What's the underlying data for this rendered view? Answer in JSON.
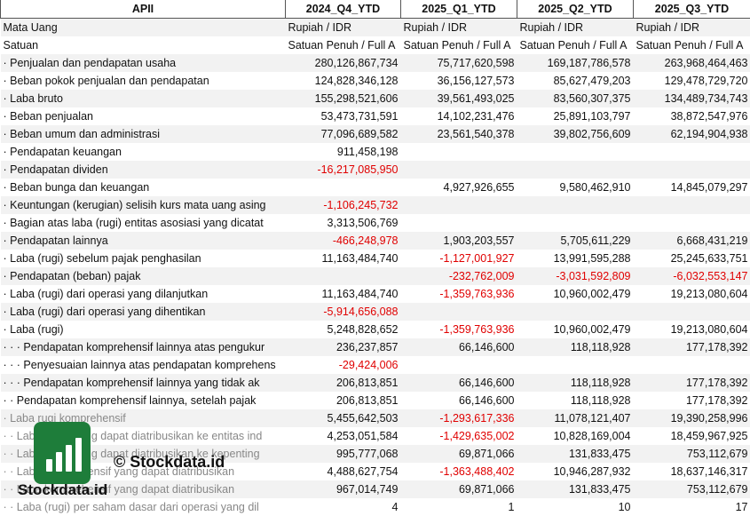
{
  "header": [
    "APII",
    "2024_Q4_YTD",
    "2025_Q1_YTD",
    "2025_Q2_YTD",
    "2025_Q3_YTD"
  ],
  "rows": [
    {
      "label": "Mata Uang",
      "values": [
        "Rupiah / IDR",
        "Rupiah / IDR",
        "Rupiah / IDR",
        "Rupiah / IDR"
      ],
      "kind": "text"
    },
    {
      "label": "Satuan",
      "values": [
        "Satuan Penuh / Full A",
        "Satuan Penuh / Full A",
        "Satuan Penuh / Full A",
        "Satuan Penuh / Full A"
      ],
      "kind": "text"
    },
    {
      "label": "· Penjualan dan pendapatan usaha",
      "values": [
        "280,126,867,734",
        "75,717,620,598",
        "169,187,786,578",
        "263,968,464,463"
      ]
    },
    {
      "label": "· Beban pokok penjualan dan pendapatan",
      "values": [
        "124,828,346,128",
        "36,156,127,573",
        "85,627,479,203",
        "129,478,729,720"
      ]
    },
    {
      "label": "· Laba bruto",
      "values": [
        "155,298,521,606",
        "39,561,493,025",
        "83,560,307,375",
        "134,489,734,743"
      ]
    },
    {
      "label": "· Beban penjualan",
      "values": [
        "53,473,731,591",
        "14,102,231,476",
        "25,891,103,797",
        "38,872,547,976"
      ]
    },
    {
      "label": "· Beban umum dan administrasi",
      "values": [
        "77,096,689,582",
        "23,561,540,378",
        "39,802,756,609",
        "62,194,904,938"
      ]
    },
    {
      "label": "· Pendapatan keuangan",
      "values": [
        "911,458,198",
        "",
        "",
        ""
      ]
    },
    {
      "label": "· Pendapatan dividen",
      "values": [
        "-16,217,085,950",
        "",
        "",
        ""
      ]
    },
    {
      "label": "· Beban bunga dan keuangan",
      "values": [
        "",
        "4,927,926,655",
        "9,580,462,910",
        "14,845,079,297"
      ]
    },
    {
      "label": "· Keuntungan (kerugian) selisih kurs mata uang asing",
      "values": [
        "-1,106,245,732",
        "",
        "",
        ""
      ]
    },
    {
      "label": "· Bagian atas laba (rugi) entitas asosiasi yang dicatat",
      "values": [
        "3,313,506,769",
        "",
        "",
        ""
      ]
    },
    {
      "label": "· Pendapatan lainnya",
      "values": [
        "-466,248,978",
        "1,903,203,557",
        "5,705,611,229",
        "6,668,431,219"
      ]
    },
    {
      "label": "· Laba (rugi) sebelum pajak penghasilan",
      "values": [
        "11,163,484,740",
        "-1,127,001,927",
        "13,991,595,288",
        "25,245,633,751"
      ]
    },
    {
      "label": "· Pendapatan (beban) pajak",
      "values": [
        "",
        "-232,762,009",
        "-3,031,592,809",
        "-6,032,553,147"
      ]
    },
    {
      "label": "· Laba (rugi) dari operasi yang dilanjutkan",
      "values": [
        "11,163,484,740",
        "-1,359,763,936",
        "10,960,002,479",
        "19,213,080,604"
      ]
    },
    {
      "label": "· Laba (rugi) dari operasi yang dihentikan",
      "values": [
        "-5,914,656,088",
        "",
        "",
        ""
      ]
    },
    {
      "label": "· Laba (rugi)",
      "values": [
        "5,248,828,652",
        "-1,359,763,936",
        "10,960,002,479",
        "19,213,080,604"
      ]
    },
    {
      "label": "· · · Pendapatan komprehensif lainnya atas pengukur",
      "values": [
        "236,237,857",
        "66,146,600",
        "118,118,928",
        "177,178,392"
      ]
    },
    {
      "label": "· · · Penyesuaian lainnya atas pendapatan komprehens",
      "values": [
        "-29,424,006",
        "",
        "",
        ""
      ]
    },
    {
      "label": "· · · Pendapatan komprehensif lainnya yang tidak ak",
      "values": [
        "206,813,851",
        "66,146,600",
        "118,118,928",
        "177,178,392"
      ]
    },
    {
      "label": "· · Pendapatan komprehensif lainnya, setelah pajak",
      "values": [
        "206,813,851",
        "66,146,600",
        "118,118,928",
        "177,178,392"
      ]
    },
    {
      "label": "· Laba rugi komprehensif",
      "values": [
        "5,455,642,503",
        "-1,293,617,336",
        "11,078,121,407",
        "19,390,258,996"
      ],
      "dim": true
    },
    {
      "label": "· · Laba (rugi) yang dapat diatribusikan ke entitas ind",
      "values": [
        "4,253,051,584",
        "-1,429,635,002",
        "10,828,169,004",
        "18,459,967,925"
      ],
      "dim": true
    },
    {
      "label": "· · Laba (rugi) yang dapat diatribusikan ke kepenting",
      "values": [
        "995,777,068",
        "69,871,066",
        "131,833,475",
        "753,112,679"
      ],
      "dim": true
    },
    {
      "label": "· · Laba komprehensif yang dapat diatribusikan",
      "values": [
        "4,488,627,754",
        "-1,363,488,402",
        "10,946,287,932",
        "18,637,146,317"
      ],
      "dim": true
    },
    {
      "label": "· · Laba komprehensif yang dapat diatribusikan",
      "values": [
        "967,014,749",
        "69,871,066",
        "131,833,475",
        "753,112,679"
      ],
      "dim": true
    },
    {
      "label": "· · Laba (rugi) per saham dasar dari operasi yang dil",
      "values": [
        "4",
        "1",
        "10",
        "17"
      ],
      "dim": true
    }
  ],
  "watermark": {
    "text": "© Stockdata.id",
    "brand": "Stockdata.id",
    "color": "#1e7d3a"
  }
}
